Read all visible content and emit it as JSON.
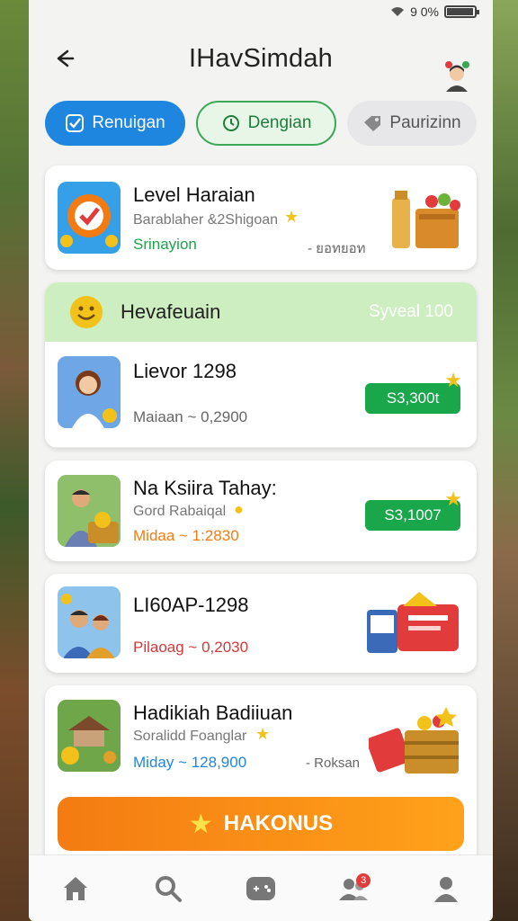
{
  "status": {
    "text": "9 0%"
  },
  "header": {
    "title": "IHavSimdah",
    "back_icon": "back-arrow-icon",
    "avatar_icon": "avatar-icon"
  },
  "tabs": [
    {
      "label": "Renuigan",
      "icon": "check-icon",
      "active": true
    },
    {
      "label": "Dengian",
      "icon": "clock-icon",
      "active": false
    },
    {
      "label": "Paurizinn",
      "icon": "tag-icon",
      "active": false
    }
  ],
  "featured": {
    "name": "Level Haraian",
    "sub": "Barablaher &2Shigoan",
    "meta_left": "Srinayion",
    "meta_right": "- ยอทยอท"
  },
  "section": {
    "title": "Hevafeuain",
    "right": "Syveal 100",
    "rows": [
      {
        "name": "Lievor 1298",
        "sub": "Maiaan ~ 0,2900",
        "btn": "S3,300t"
      },
      {
        "name": "Na Ksiira Tahay:",
        "sub": "Gord Rabaiqal",
        "meta": "Midaa ~ 1:2830",
        "btn": "S3,1007"
      }
    ]
  },
  "card3": {
    "name": "LI60AP-1298",
    "meta": "Pilaoag ~ 0,2030"
  },
  "card4": {
    "name": "Hadikiah Badiiuan",
    "sub": "Soralidd Foanglar",
    "meta": "Miday ~ 128,900",
    "meta_right": "- Roksan",
    "bonus": "HAKONUS"
  },
  "colors": {
    "primary": "#1f86e0",
    "green": "#1aa64a",
    "orange": "#f47b12",
    "section_bg": "#cdeec0"
  },
  "battery_level": 0.9
}
